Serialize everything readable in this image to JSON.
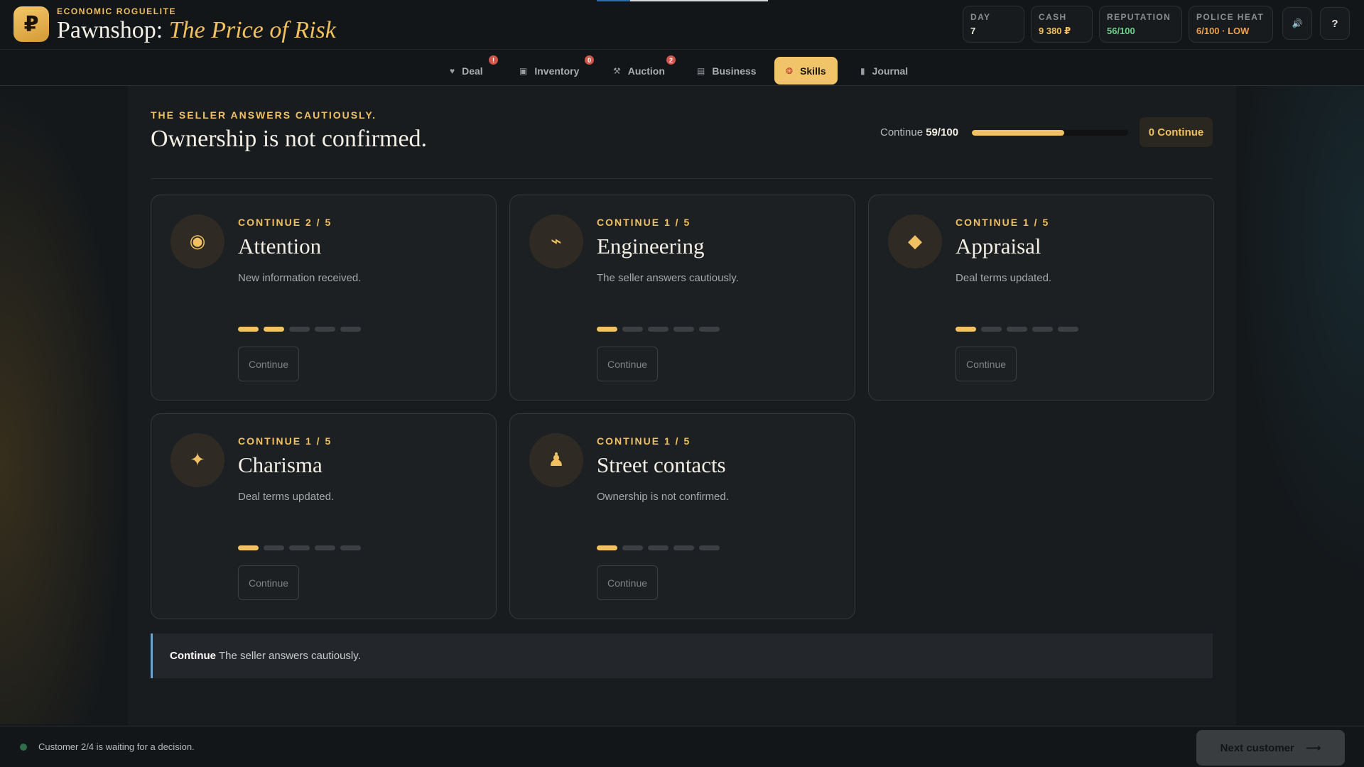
{
  "header": {
    "eyebrow": "ECONOMIC ROGUELITE",
    "title_main": "Pawnshop:",
    "title_italic": "The Price of Risk",
    "logo_glyph": "₽",
    "stats": [
      {
        "label": "DAY",
        "value": "7",
        "color": "#f1ede3"
      },
      {
        "label": "CASH",
        "value": "9 380 ₽",
        "color": "#f2c15e"
      },
      {
        "label": "REPUTATION",
        "value": "56/100",
        "color": "#6fcf8a"
      },
      {
        "label": "POLICE HEAT",
        "value": "6/100 · LOW",
        "color": "#f0a048"
      }
    ],
    "sound_icon": "🔊",
    "help_label": "?"
  },
  "nav": {
    "tabs": [
      {
        "label": "Deal",
        "icon": "heart-icon",
        "glyph": "♥",
        "badge": "!"
      },
      {
        "label": "Inventory",
        "icon": "box-icon",
        "glyph": "▣",
        "badge": "0"
      },
      {
        "label": "Auction",
        "icon": "gavel-icon",
        "glyph": "⚒",
        "badge": "2"
      },
      {
        "label": "Business",
        "icon": "briefcase-icon",
        "glyph": "▤",
        "badge": ""
      },
      {
        "label": "Skills",
        "icon": "brain-icon",
        "glyph": "❂",
        "badge": "",
        "active": true
      },
      {
        "label": "Journal",
        "icon": "book-icon",
        "glyph": "▮",
        "badge": ""
      }
    ]
  },
  "main": {
    "eyebrow": "THE SELLER ANSWERS CAUTIOUSLY.",
    "title": "Ownership is not confirmed.",
    "progress_label": "Continue",
    "progress_value": "59/100",
    "progress_fraction": 0.59,
    "points_button": "0 Continue",
    "skills": [
      {
        "level": "CONTINUE 2 / 5",
        "name": "Attention",
        "desc": "New information received.",
        "icon": "eye-target-icon",
        "glyph": "◉",
        "filled": 2,
        "button": "Continue"
      },
      {
        "level": "CONTINUE 1 / 5",
        "name": "Engineering",
        "desc": "The seller answers cautiously.",
        "icon": "wrench-icon",
        "glyph": "⌁",
        "filled": 1,
        "button": "Continue"
      },
      {
        "level": "CONTINUE 1 / 5",
        "name": "Appraisal",
        "desc": "Deal terms updated.",
        "icon": "diamond-icon",
        "glyph": "◆",
        "filled": 1,
        "button": "Continue"
      },
      {
        "level": "CONTINUE 1 / 5",
        "name": "Charisma",
        "desc": "Deal terms updated.",
        "icon": "sparkle-icon",
        "glyph": "✦",
        "filled": 1,
        "button": "Continue"
      },
      {
        "level": "CONTINUE 1 / 5",
        "name": "Street contacts",
        "desc": "Ownership is not confirmed.",
        "icon": "pawn-icon",
        "glyph": "♟",
        "filled": 1,
        "button": "Continue"
      }
    ],
    "log": {
      "strong": "Continue",
      "text": "The seller answers cautiously."
    }
  },
  "footer": {
    "status": "Customer 2/4 is waiting for a decision.",
    "next_button": "Next customer",
    "next_arrow": "⟶"
  }
}
